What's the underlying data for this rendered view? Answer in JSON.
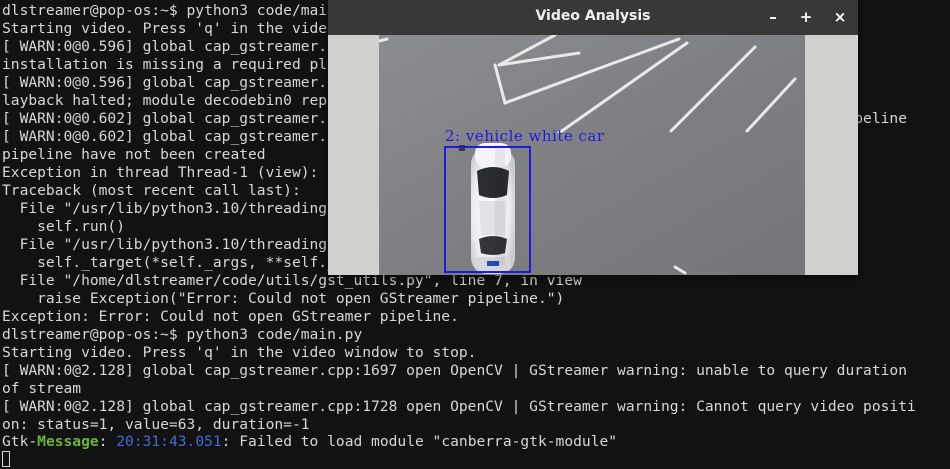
{
  "terminal": {
    "lines": [
      {
        "text": "dlstreamer@pop-os:~$ python3 code/main.py"
      },
      {
        "text": "Starting video. Press 'q' in the video window to stop."
      },
      {
        "text": "[ WARN:0@0.596] global cap_gstreamer.cpp:1697 open OpenCV | GStreamer warning: GStreamer i"
      },
      {
        "text": "installation is missing a required plugin"
      },
      {
        "text": "[ WARN:0@0.596] global cap_gstreamer.cpp:1728 open OpenCV | GStreamer warning: Embedded video p"
      },
      {
        "text": "layback halted; module decodebin0 reported: Your GStreamer installation is missing a plug-in."
      },
      {
        "text": "[ WARN:0@0.602] global cap_gstreamer.cpp:1728 open OpenCV | GStreamer warning: unable to start pipeline"
      },
      {
        "text": "[ WARN:0@0.602] global cap_gstreamer.cpp:1728 open OpenCV | GStreamer warning: GStreamer: p"
      },
      {
        "text": "pipeline have not been created"
      },
      {
        "text": "Exception in thread Thread-1 (view):"
      },
      {
        "text": "Traceback (most recent call last):"
      },
      {
        "text": "  File \"/usr/lib/python3.10/threading.py\", line 1016, in _bootstrap_inner"
      },
      {
        "text": "    self.run()"
      },
      {
        "text": "  File \"/usr/lib/python3.10/threading.py\", line 953, in run"
      },
      {
        "text": "    self._target(*self._args, **self._kwargs)"
      },
      {
        "text": "  File \"/home/dlstreamer/code/utils/gst_utils.py\", line 7, in view"
      },
      {
        "text": "    raise Exception(\"Error: Could not open GStreamer pipeline.\")"
      },
      {
        "text": "Exception: Error: Could not open GStreamer pipeline."
      },
      {
        "text": "dlstreamer@pop-os:~$ python3 code/main.py"
      },
      {
        "text": "Starting video. Press 'q' in the video window to stop."
      },
      {
        "text": "[ WARN:0@2.128] global cap_gstreamer.cpp:1697 open OpenCV | GStreamer warning: unable to query duration"
      },
      {
        "text": "of stream"
      },
      {
        "text": "[ WARN:0@2.128] global cap_gstreamer.cpp:1728 open OpenCV | GStreamer warning: Cannot query video positi"
      },
      {
        "text": "on: status=1, value=63, duration=-1"
      }
    ],
    "gtk_message": {
      "prefix": "Gtk-",
      "label": "Message",
      "colon": ": ",
      "time": "20:31:43.051",
      "text": ": Failed to load module \"canberra-gtk-module\""
    },
    "colors": {
      "background": "#121212",
      "text": "#d7d7d7",
      "gtk_label": "#6cb33b",
      "gtk_time": "#3b6fd6"
    }
  },
  "video_window": {
    "title": "Video Analysis",
    "minimize_icon": "minimize-icon",
    "maximize_icon": "maximize-icon",
    "close_icon": "close-icon",
    "minimize_glyph": "–",
    "maximize_glyph": "+",
    "close_glyph": "×",
    "detection": {
      "label": "2: vehicle white car",
      "box_color": "#1c1ce0"
    }
  }
}
